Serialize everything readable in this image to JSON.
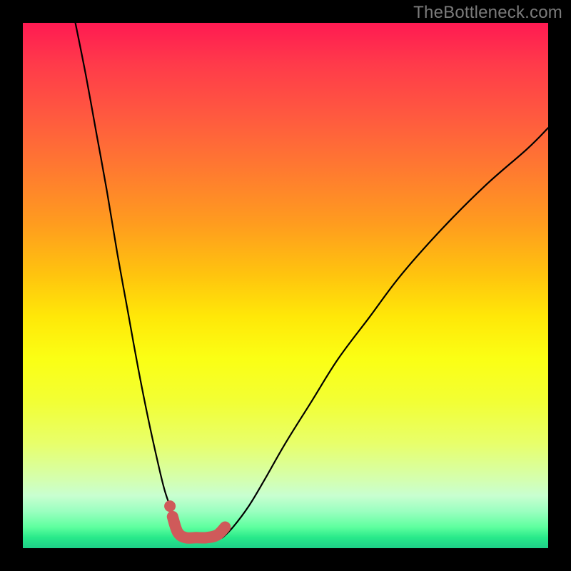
{
  "watermark": "TheBottleneck.com",
  "chart_data": {
    "type": "line",
    "title": "",
    "xlabel": "",
    "ylabel": "",
    "xlim": [
      0,
      100
    ],
    "ylim": [
      0,
      100
    ],
    "series": [
      {
        "name": "left-curve",
        "x": [
          10,
          12,
          14,
          16,
          18,
          20,
          22,
          24,
          26,
          27,
          28,
          29,
          30,
          31
        ],
        "y": [
          100,
          90,
          79,
          68,
          56,
          45,
          34,
          24,
          15,
          11,
          8,
          5,
          3,
          2
        ]
      },
      {
        "name": "right-curve",
        "x": [
          38,
          40,
          43,
          46,
          50,
          55,
          60,
          66,
          72,
          80,
          88,
          96,
          100
        ],
        "y": [
          2,
          4,
          8,
          13,
          20,
          28,
          36,
          44,
          52,
          61,
          69,
          76,
          80
        ]
      },
      {
        "name": "highlight-segment",
        "x": [
          28.5,
          29.5,
          31,
          33,
          35,
          37,
          38.5
        ],
        "y": [
          6,
          3,
          2,
          2,
          2,
          2.5,
          4
        ]
      }
    ],
    "annotations": [
      {
        "name": "highlight-dot",
        "x": 28,
        "y": 8
      }
    ],
    "background_gradient": {
      "top": "#ff1a52",
      "mid": "#ffe808",
      "bottom": "#1ecf88"
    }
  }
}
